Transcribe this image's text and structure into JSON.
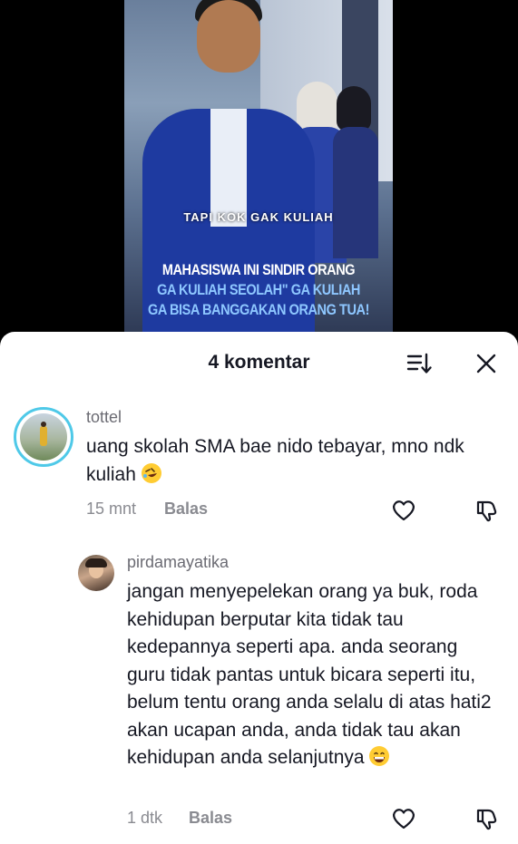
{
  "video": {
    "caption_small": "TAPI KOK GAK KULIAH",
    "headline": [
      {
        "text": "MAHASISWA INI SINDIR ORANG",
        "color": "#ffffff"
      },
      {
        "text": "GA KULIAH SEOLAH\" GA KULIAH",
        "color": "#8ec7ff"
      },
      {
        "text": "GA BISA BANGGAKAN ORANG TUA!",
        "color": "#8ec7ff"
      }
    ]
  },
  "sheet": {
    "title": "4 komentar",
    "sort_icon": "sort-icon",
    "close_icon": "close-icon"
  },
  "comments": [
    {
      "username": "tottel",
      "text": "uang skolah SMA bae nido tebayar, mno ndk kuliah",
      "emoji": "rolling-on-floor-laughing",
      "time": "15 mnt",
      "reply_label": "Balas"
    },
    {
      "username": "pirdamayatika",
      "text": "jangan menyepelekan orang ya buk, roda kehidupan berputar kita tidak tau kedepannya seperti apa. anda seorang guru tidak pantas untuk bicara seperti itu, belum tentu orang anda selalu di atas hati2 akan ucapan anda, anda tidak tau akan kehidupan anda selanjutnya",
      "emoji": "grinning-face",
      "time": "1 dtk",
      "reply_label": "Balas"
    }
  ]
}
